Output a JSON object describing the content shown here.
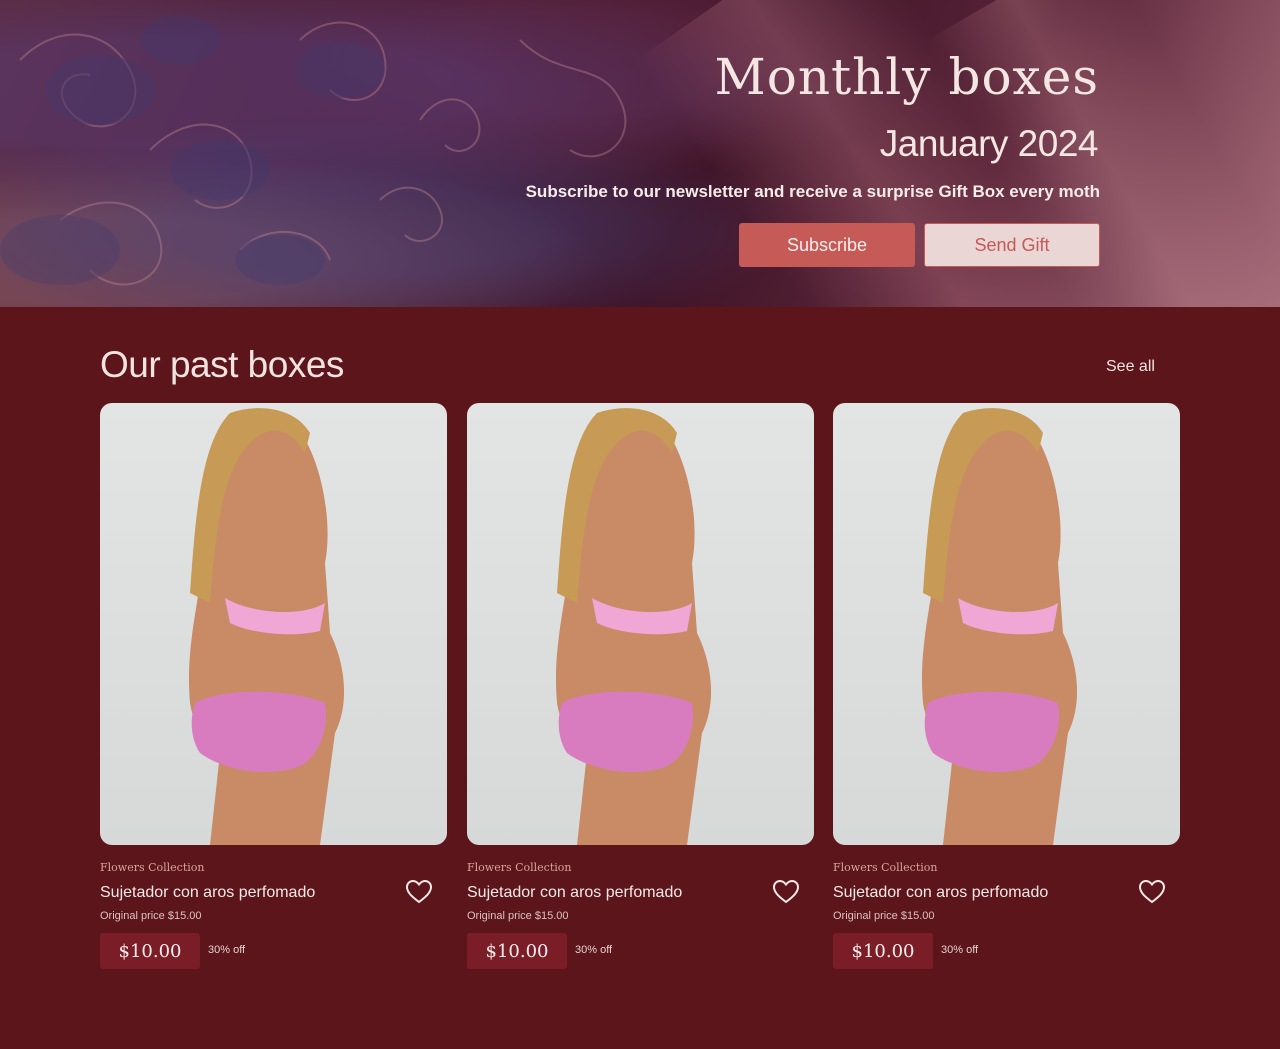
{
  "hero": {
    "title": "Monthly boxes",
    "date": "January 2024",
    "subtitle": "Subscribe to our newsletter and receive a surprise Gift Box every moth",
    "subscribe_label": "Subscribe",
    "send_gift_label": "Send Gift"
  },
  "past": {
    "title": "Our past boxes",
    "see_all": "See all",
    "cards": [
      {
        "collection": "Flowers Collection",
        "name": "Sujetador con aros perfomado",
        "original": "Original price $15.00",
        "price": "$10.00",
        "discount": "30% off"
      },
      {
        "collection": "Flowers Collection",
        "name": "Sujetador con aros perfomado",
        "original": "Original price $15.00",
        "price": "$10.00",
        "discount": "30% off"
      },
      {
        "collection": "Flowers Collection",
        "name": "Sujetador con aros perfomado",
        "original": "Original price $15.00",
        "price": "$10.00",
        "discount": "30% off"
      }
    ]
  },
  "colors": {
    "background": "#5b151b",
    "accent": "#c55a56",
    "price_bg": "#7a1d27"
  },
  "icons": [
    "heart-icon"
  ]
}
